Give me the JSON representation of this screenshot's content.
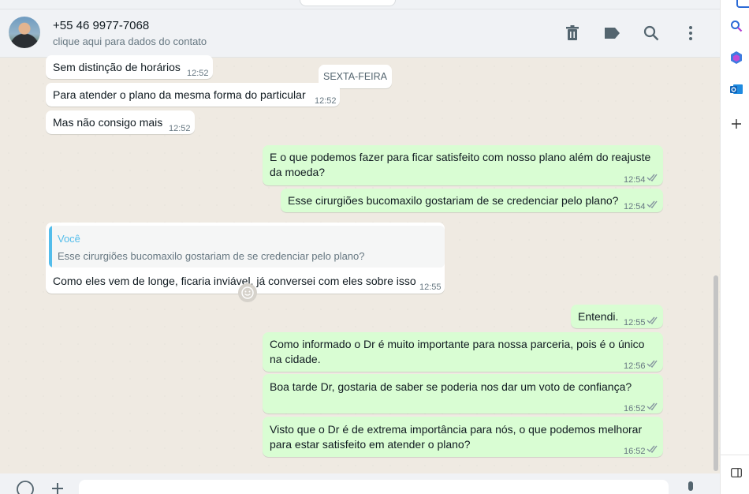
{
  "header": {
    "contact_name": "+55 46 9977-7068",
    "contact_subtitle": "clique aqui para dados do contato",
    "icons": [
      "delete-icon",
      "label-icon",
      "search-icon",
      "menu-icon"
    ]
  },
  "day_separator": "SEXTA-FEIRA",
  "messages": [
    {
      "dir": "in",
      "text": "Sem distinção de horários",
      "time": "12:52"
    },
    {
      "dir": "in",
      "text": "Para atender o plano da mesma forma do particular",
      "time": "12:52"
    },
    {
      "dir": "in",
      "text": "Mas não consigo mais",
      "time": "12:52"
    },
    {
      "dir": "out",
      "text_line1": "E o que podemos fazer para ficar satisfeito com nosso plano além do reajuste",
      "text_line2": "da moeda?",
      "time": "12:54"
    },
    {
      "dir": "out",
      "text": "Esse cirurgiões bucomaxilo gostariam de se credenciar pelo plano?",
      "time": "12:54"
    },
    {
      "dir": "in",
      "quote_author": "Você",
      "quote_text": "Esse cirurgiões bucomaxilo gostariam de se credenciar pelo plano?",
      "text": "Como eles vem de longe, ficaria inviável, já conversei com eles sobre isso",
      "time": "12:55"
    },
    {
      "dir": "out",
      "text": "Entendi.",
      "time": "12:55"
    },
    {
      "dir": "out",
      "text_line1": "Como informado o Dr é muito importante para nossa parceria, pois é o único",
      "text_line2": "na cidade.",
      "time": "12:56"
    },
    {
      "dir": "out",
      "text": "Boa tarde Dr, gostaria de saber se poderia nos dar um voto de confiança?",
      "time": "16:52"
    },
    {
      "dir": "out",
      "text_line1": "Visto que o Dr é de extrema importância para nós, o que podemos melhorar",
      "text_line2": "para estar satisfeito em atender o plano?",
      "time": "16:52"
    }
  ],
  "composer": {
    "icons": [
      "emoji-icon",
      "attach-icon",
      "microphone-icon"
    ]
  },
  "sidebar_icons": [
    "search-icon",
    "copilot-icon",
    "outlook-icon",
    "add-icon",
    "panel-icon"
  ],
  "colors": {
    "incoming": "#ffffff",
    "outgoing": "#d9fdd3",
    "read_ticks": "#53bdeb",
    "quote_accent": "#53bdeb"
  }
}
